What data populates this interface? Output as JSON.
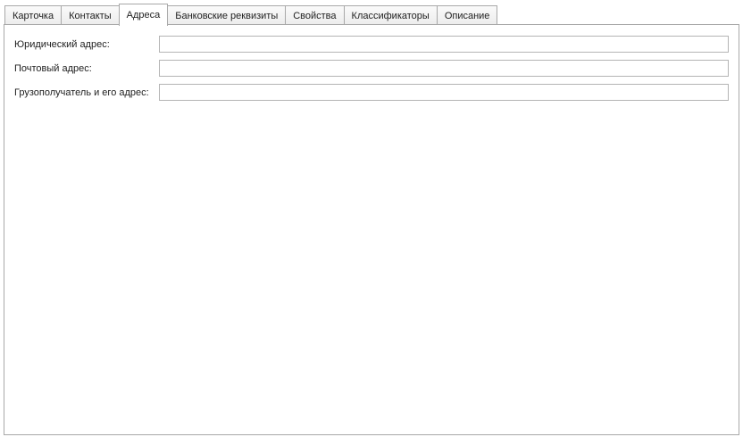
{
  "tabs": [
    {
      "label": "Карточка",
      "active": false
    },
    {
      "label": "Контакты",
      "active": false
    },
    {
      "label": "Адреса",
      "active": true
    },
    {
      "label": "Банковские реквизиты",
      "active": false
    },
    {
      "label": "Свойства",
      "active": false
    },
    {
      "label": "Классификаторы",
      "active": false
    },
    {
      "label": "Описание",
      "active": false
    }
  ],
  "addresses": {
    "legal": {
      "label": "Юридический адрес:",
      "value": ""
    },
    "postal": {
      "label": "Почтовый адрес:",
      "value": ""
    },
    "consignee": {
      "label": "Грузополучатель и его адрес:",
      "value": ""
    }
  },
  "colors": {
    "border": "#a8a8a8",
    "field_border": "#b4b4b4",
    "tab_background": "#ececec",
    "active_tab_background": "#ffffff"
  }
}
